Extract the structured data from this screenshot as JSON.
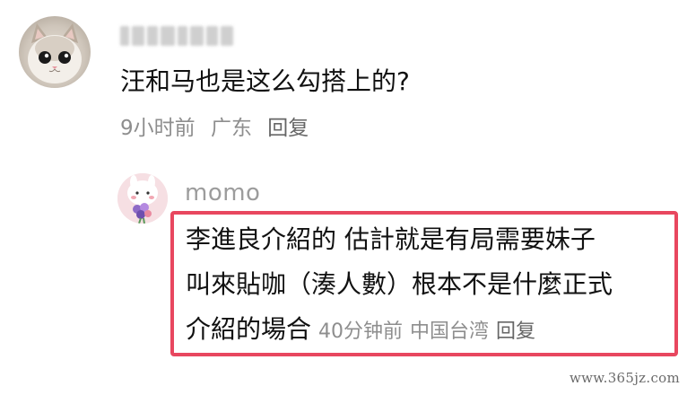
{
  "comments": [
    {
      "username_visible": false,
      "text": "汪和马也是这么勾搭上的?",
      "time": "9小时前",
      "location": "广东",
      "reply_label": "回复",
      "avatar_icon": "cat-avatar-icon"
    }
  ],
  "reply": {
    "username": "momo",
    "text_lines": [
      "李進良介紹的 估計就是有局需要妹子",
      "叫來貼咖（湊人數）根本不是什麼正式",
      "介紹的場合"
    ],
    "time": "40分钟前",
    "location": "中国台湾",
    "reply_label": "回复",
    "avatar_icon": "bunny-flower-avatar-icon",
    "highlight_color": "#e8475f"
  },
  "watermark": "www.365jz.com"
}
